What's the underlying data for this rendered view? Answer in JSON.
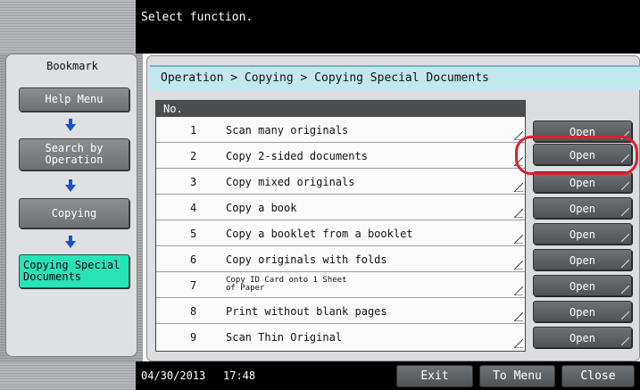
{
  "header": {
    "message": "Select function."
  },
  "sidebar": {
    "title": "Bookmark",
    "items": [
      {
        "label": "Help Menu"
      },
      {
        "label": "Search by\nOperation"
      },
      {
        "label": "Copying"
      },
      {
        "label": "Copying Special\nDocuments"
      }
    ]
  },
  "main": {
    "breadcrumb": "Operation > Copying > Copying Special Documents",
    "column_header": "No.",
    "rows": [
      {
        "num": "1",
        "name": "Scan many originals"
      },
      {
        "num": "2",
        "name": "Copy 2-sided documents"
      },
      {
        "num": "3",
        "name": "Copy mixed originals"
      },
      {
        "num": "4",
        "name": "Copy a book"
      },
      {
        "num": "5",
        "name": "Copy a booklet from a booklet"
      },
      {
        "num": "6",
        "name": "Copy originals with folds"
      },
      {
        "num": "7",
        "name": "Copy ID Card onto 1 Sheet of Paper"
      },
      {
        "num": "8",
        "name": "Print without blank pages"
      },
      {
        "num": "9",
        "name": "Scan Thin Original"
      }
    ],
    "open_label": "Open",
    "highlight_color": "#e01f2a"
  },
  "footer": {
    "date": "04/30/2013",
    "time": "17:48",
    "exit_label": "Exit",
    "to_menu_label": "To Menu",
    "close_label": "Close"
  }
}
